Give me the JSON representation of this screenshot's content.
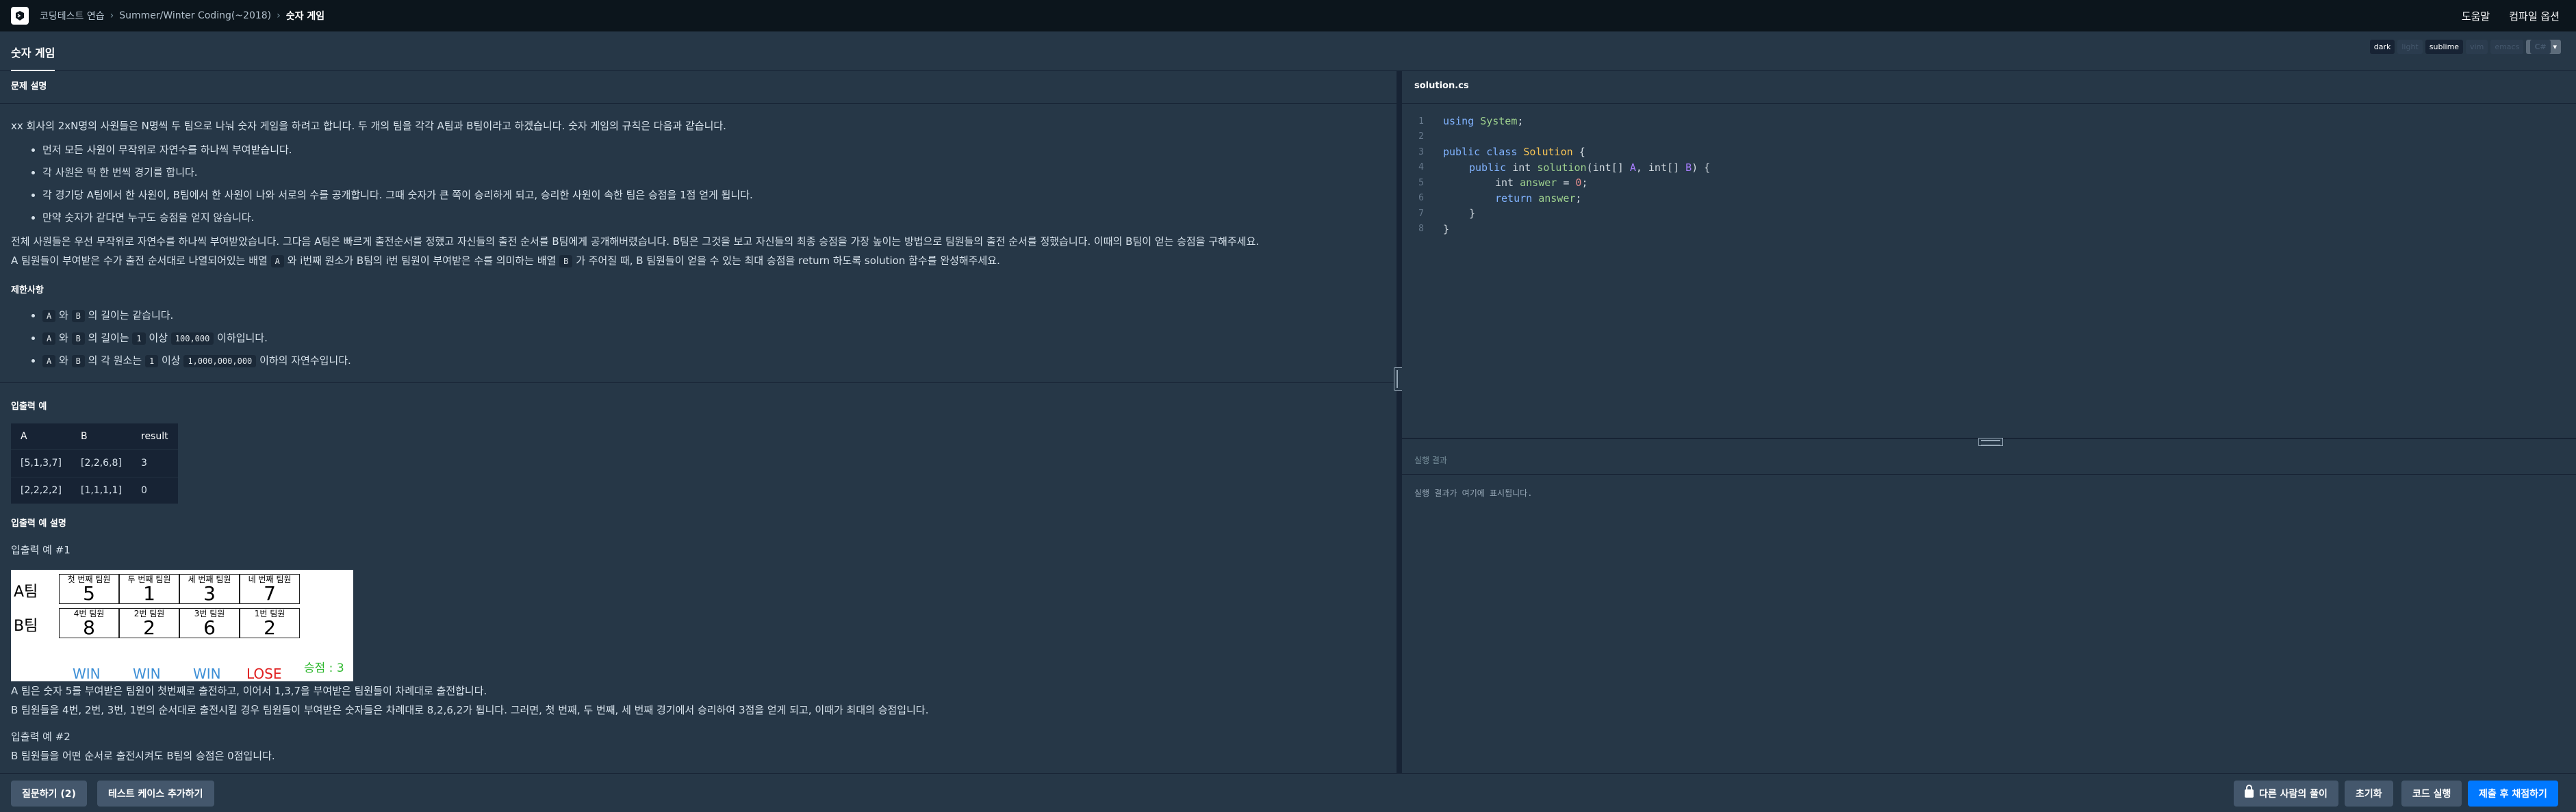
{
  "nav": {
    "breadcrumbs": [
      "코딩테스트 연습",
      "Summer/Winter Coding(~2018)",
      "숫자 게임"
    ],
    "help": "도움말",
    "compile_options": "컴파일 옵션"
  },
  "tab": {
    "title": "숫자 게임"
  },
  "themes": [
    "dark",
    "light",
    "sublime",
    "vim",
    "emacs"
  ],
  "active_theme": "sublime",
  "language": "C#",
  "problem": {
    "heading": "문제 설명",
    "intro": "xx 회사의 2xN명의 사원들은 N명씩 두 팀으로 나눠 숫자 게임을 하려고 합니다. 두 개의 팀을 각각 A팀과 B팀이라고 하겠습니다. 숫자 게임의 규칙은 다음과 같습니다.",
    "rules": [
      "먼저 모든 사원이 무작위로 자연수를 하나씩 부여받습니다.",
      "각 사원은 딱 한 번씩 경기를 합니다.",
      "각 경기당 A팀에서 한 사원이, B팀에서 한 사원이 나와 서로의 수를 공개합니다. 그때 숫자가 큰 쪽이 승리하게 되고, 승리한 사원이 속한 팀은 승점을 1점 얻게 됩니다.",
      "만약 숫자가 같다면 누구도 승점을 얻지 않습니다."
    ],
    "para1": "전체 사원들은 우선 무작위로 자연수를 하나씩 부여받았습니다. 그다음 A팀은 빠르게 출전순서를 정했고 자신들의 출전 순서를 B팀에게 공개해버렸습니다. B팀은 그것을 보고 자신들의 최종 승점을 가장 높이는 방법으로 팀원들의 출전 순서를 정했습니다. 이때의 B팀이 얻는 승점을 구해주세요.",
    "para2_a": "A 팀원들이 부여받은 수가 출전 순서대로 나열되어있는 배열",
    "para2_code1": "A",
    "para2_b": "와 i번째 원소가 B팀의 i번 팀원이 부여받은 수를 의미하는 배열",
    "para2_code2": "B",
    "para2_c": "가 주어질 때, B 팀원들이 얻을 수 있는 최대 승점을 return 하도록 solution 함수를 완성해주세요."
  },
  "constraints": {
    "heading": "제한사항",
    "items": [
      {
        "c1": "A",
        "t1": "와",
        "c2": "B",
        "t2": "의 길이는 같습니다."
      },
      {
        "c1": "A",
        "t1": "와",
        "c2": "B",
        "t2": "의 길이는",
        "c3": "1",
        "t3": "이상",
        "c4": "100,000",
        "t4": "이하입니다."
      },
      {
        "c1": "A",
        "t1": "와",
        "c2": "B",
        "t2": "의 각 원소는",
        "c3": "1",
        "t3": "이상",
        "c4": "1,000,000,000",
        "t4": "이하의 자연수입니다."
      }
    ]
  },
  "io_example": {
    "heading": "입출력 예",
    "columns": [
      "A",
      "B",
      "result"
    ],
    "rows": [
      [
        "[5,1,3,7]",
        "[2,2,6,8]",
        "3"
      ],
      [
        "[2,2,2,2]",
        "[1,1,1,1]",
        "0"
      ]
    ]
  },
  "io_explanation": {
    "heading": "입출력 예 설명",
    "ex1_title": "입출력 예 #1",
    "figure": {
      "team_a": "A팀",
      "team_b": "B팀",
      "a_members": [
        {
          "title": "첫 번째 팀원",
          "value": "5"
        },
        {
          "title": "두 번째 팀원",
          "value": "1"
        },
        {
          "title": "세 번째 팀원",
          "value": "3"
        },
        {
          "title": "네 번째 팀원",
          "value": "7"
        }
      ],
      "b_members": [
        {
          "title": "4번 팀원",
          "value": "8"
        },
        {
          "title": "2번 팀원",
          "value": "2"
        },
        {
          "title": "3번 팀원",
          "value": "6"
        },
        {
          "title": "1번 팀원",
          "value": "2"
        }
      ],
      "results": [
        "WIN",
        "WIN",
        "WIN",
        "LOSE"
      ],
      "score": "승점 : 3",
      "colors": {
        "win": "#3d8fd6",
        "lose": "#e02020",
        "score": "#2eb82e"
      }
    },
    "ex1_line1": "A 팀은 숫자 5를 부여받은 팀원이 첫번째로 출전하고, 이어서 1,3,7을 부여받은 팀원들이 차례대로 출전합니다.",
    "ex1_line2": "B 팀원들을 4번, 2번, 3번, 1번의 순서대로 출전시킬 경우 팀원들이 부여받은 숫자들은 차례대로 8,2,6,2가 됩니다. 그러면, 첫 번째, 두 번째, 세 번째 경기에서 승리하여 3점을 얻게 되고, 이때가 최대의 승점입니다.",
    "ex2_title": "입출력 예 #2",
    "ex2_line1": "B 팀원들을 어떤 순서로 출전시켜도 B팀의 승점은 0점입니다."
  },
  "editor": {
    "filename": "solution.cs",
    "line_numbers": [
      "1",
      "2",
      "3",
      "4",
      "5",
      "6",
      "7",
      "8"
    ]
  },
  "result": {
    "heading": "실행 결과",
    "placeholder": "실행 결과가 여기에 표시됩니다."
  },
  "bottom": {
    "ask": "질문하기 (2)",
    "add_testcase": "테스트 케이스 추가하기",
    "others": "다른 사람의 풀이",
    "reset": "초기화",
    "run": "코드 실행",
    "submit": "제출 후 채점하기"
  }
}
